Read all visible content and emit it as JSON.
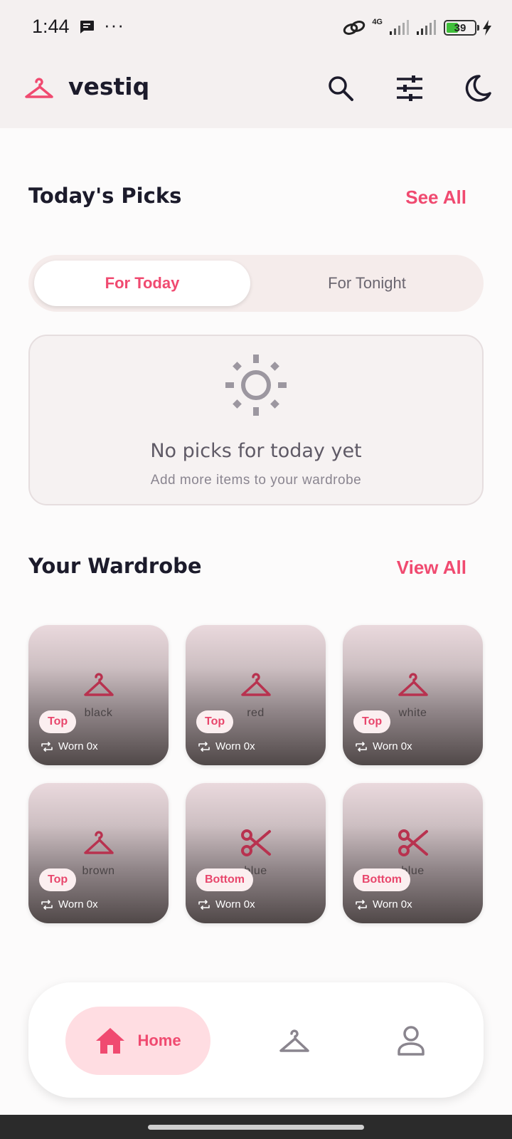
{
  "status_bar": {
    "time": "1:44",
    "battery_level": "39",
    "network_label": "4G"
  },
  "app_bar": {
    "title": "vestiq",
    "logo_icon": "hanger-icon",
    "actions": [
      "search-icon",
      "tune-icon",
      "moon-icon"
    ]
  },
  "todays_picks": {
    "title": "Today's Picks",
    "see_all": "See All",
    "tabs": [
      {
        "label": "For Today",
        "selected": true
      },
      {
        "label": "For Tonight",
        "selected": false
      }
    ],
    "empty_state": {
      "icon": "sun-icon",
      "title": "No picks for today yet",
      "subtitle": "Add more items to your wardrobe"
    }
  },
  "wardrobe": {
    "title": "Your Wardrobe",
    "view_all": "View All",
    "items": [
      {
        "color_name": "black",
        "category": "Top",
        "worn": "Worn 0x",
        "icon": "hanger-icon"
      },
      {
        "color_name": "red",
        "category": "Top",
        "worn": "Worn 0x",
        "icon": "hanger-icon"
      },
      {
        "color_name": "white",
        "category": "Top",
        "worn": "Worn 0x",
        "icon": "hanger-icon"
      },
      {
        "color_name": "brown",
        "category": "Top",
        "worn": "Worn 0x",
        "icon": "hanger-icon"
      },
      {
        "color_name": "blue",
        "category": "Bottom",
        "worn": "Worn 0x",
        "icon": "scissors-icon"
      },
      {
        "color_name": "blue",
        "category": "Bottom",
        "worn": "Worn 0x",
        "icon": "scissors-icon"
      }
    ]
  },
  "bottom_nav": {
    "items": [
      {
        "label": "Home",
        "icon": "home-icon",
        "selected": true
      },
      {
        "label": "",
        "icon": "hanger-icon",
        "selected": false
      },
      {
        "label": "",
        "icon": "person-icon",
        "selected": false
      }
    ]
  },
  "colors": {
    "accent": "#f04a70",
    "icon_dark_red": "#b8324f",
    "text_dark": "#1c1b2b"
  }
}
